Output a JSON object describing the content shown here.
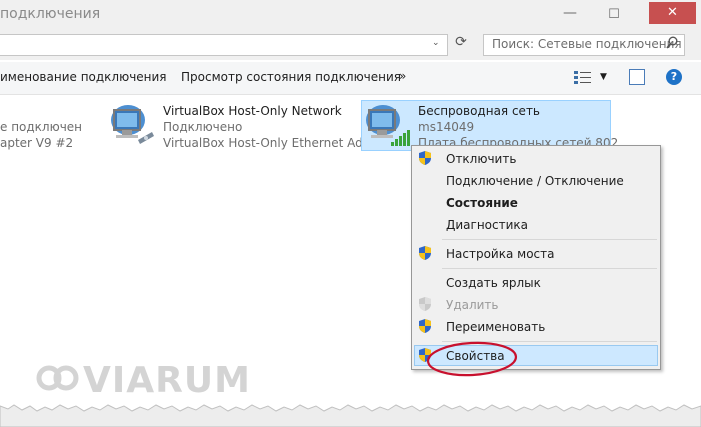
{
  "window": {
    "title": "подключения",
    "minimize_glyph": "—",
    "maximize_glyph": "☐",
    "close_glyph": "✕"
  },
  "address": {
    "search_placeholder": "Поиск: Сетевые подключения",
    "chevron_glyph": "⌄",
    "refresh_glyph": "⟳"
  },
  "toolbar": {
    "rename": "именование подключения",
    "view_status": "Просмотр состояния подключения",
    "more": "»",
    "help": "?"
  },
  "connections": [
    {
      "name": "",
      "status": "е подключен",
      "adapter": "apter V9 #2"
    },
    {
      "name": "VirtualBox Host-Only Network",
      "status": "Подключено",
      "adapter": "VirtualBox Host-Only Ethernet Ad..."
    },
    {
      "name": "Беспроводная сеть",
      "status": "ms14049",
      "adapter": "Плата беспроводных сетей 802...."
    }
  ],
  "context_menu": {
    "items": [
      {
        "label": "Отключить",
        "shield": true,
        "bold": false,
        "disabled": false
      },
      {
        "label": "Подключение / Отключение",
        "shield": false,
        "bold": false,
        "disabled": false
      },
      {
        "label": "Состояние",
        "shield": false,
        "bold": true,
        "disabled": false
      },
      {
        "label": "Диагностика",
        "shield": false,
        "bold": false,
        "disabled": false
      },
      {
        "label": "Настройка моста",
        "shield": true,
        "bold": false,
        "disabled": false
      },
      {
        "label": "Создать ярлык",
        "shield": false,
        "bold": false,
        "disabled": false
      },
      {
        "label": "Удалить",
        "shield": true,
        "bold": false,
        "disabled": true
      },
      {
        "label": "Переименовать",
        "shield": true,
        "bold": false,
        "disabled": false
      },
      {
        "label": "Свойства",
        "shield": true,
        "bold": false,
        "disabled": false,
        "highlighted": true
      }
    ]
  },
  "watermark": {
    "text": "VIARUM"
  },
  "colors": {
    "close": "#c75050",
    "selection": "#cce8ff",
    "annotation": "#c8102e",
    "signal": "#3aa33a"
  },
  "icons": [
    "search-icon",
    "refresh-icon",
    "view-icon",
    "preview-pane-icon",
    "help-icon",
    "network-computer-icon",
    "wifi-signal-icon",
    "uac-shield-icon"
  ]
}
